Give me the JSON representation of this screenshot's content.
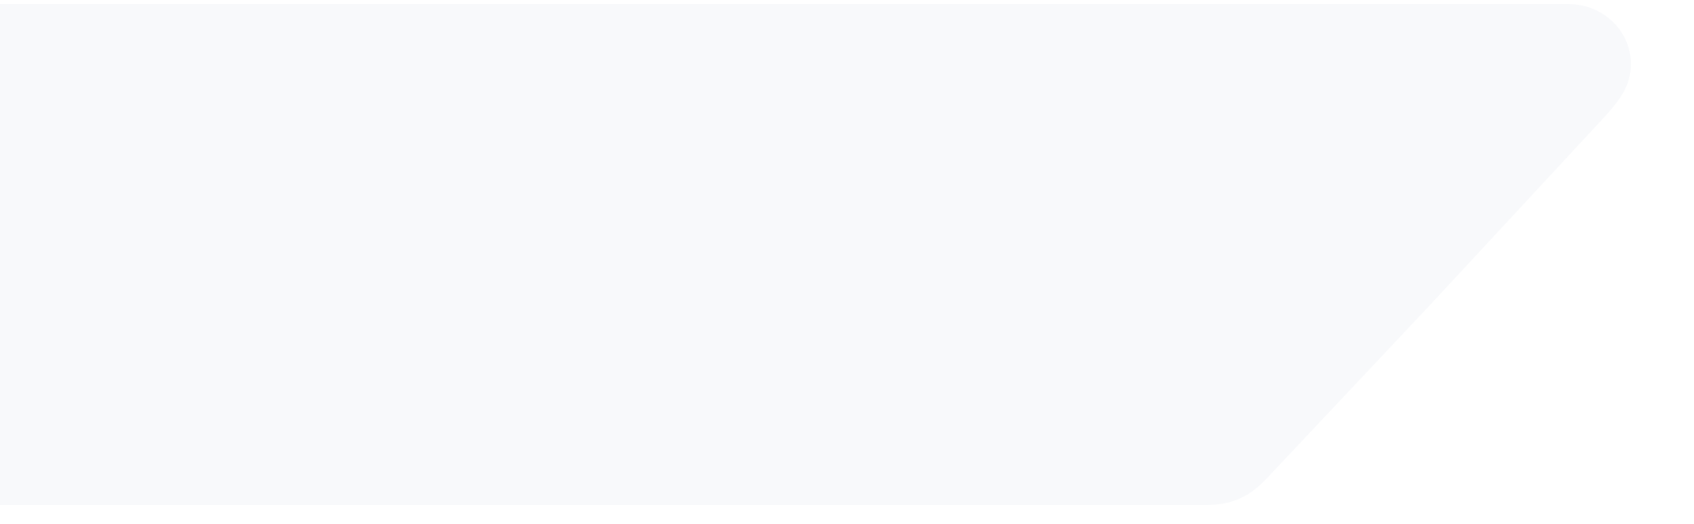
{
  "colors": {
    "background": "#ffffff",
    "banner_fill": "#f8f9fb"
  }
}
